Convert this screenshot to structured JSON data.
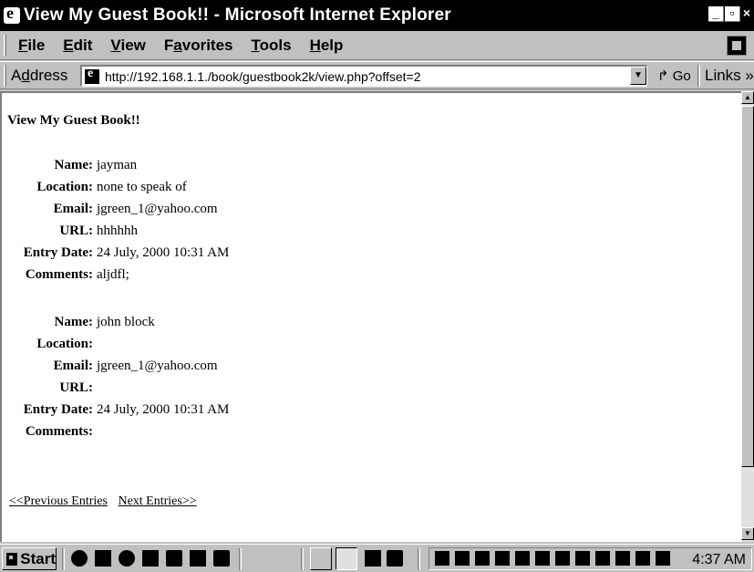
{
  "window": {
    "title": "View My Guest Book!! - Microsoft Internet Explorer",
    "min_label": "_",
    "max_label": "▫",
    "close_label": "×"
  },
  "menu": {
    "file": {
      "first": "F",
      "rest": "ile"
    },
    "edit": {
      "first": "E",
      "rest": "dit"
    },
    "view": {
      "first": "V",
      "rest": "iew"
    },
    "favorites": {
      "pre": "F",
      "ul": "a",
      "rest": "vorites"
    },
    "tools": {
      "first": "T",
      "rest": "ools"
    },
    "help": {
      "first": "H",
      "rest": "elp"
    }
  },
  "address": {
    "label_pre": "A",
    "label_ul": "d",
    "label_rest": "dress",
    "url": "http://192.168.1.1./book/guestbook2k/view.php?offset=2",
    "go_label": "Go",
    "links_label": "Links »"
  },
  "page": {
    "heading": "View My Guest Book!!",
    "labels": {
      "name": "Name:",
      "location": "Location:",
      "email": "Email:",
      "url": "URL:",
      "entry_date": "Entry Date:",
      "comments": "Comments:"
    },
    "entries": [
      {
        "name": "jayman",
        "location": "none to speak of",
        "email": "jgreen_1@yahoo.com",
        "url": "hhhhhh",
        "entry_date": "24 July, 2000 10:31 AM",
        "comments": "aljdfl;"
      },
      {
        "name": "john block",
        "location": "",
        "email": "jgreen_1@yahoo.com",
        "url": "",
        "entry_date": "24 July, 2000 10:31 AM",
        "comments": ""
      }
    ],
    "prev_link": "<<Previous Entries",
    "next_link": "Next Entries>>"
  },
  "taskbar": {
    "start_label": "Start",
    "clock": "4:37 AM"
  },
  "colors": {
    "chrome": "#c0c0c0",
    "title_bar": "#000000",
    "content_bg": "#ffffff"
  }
}
